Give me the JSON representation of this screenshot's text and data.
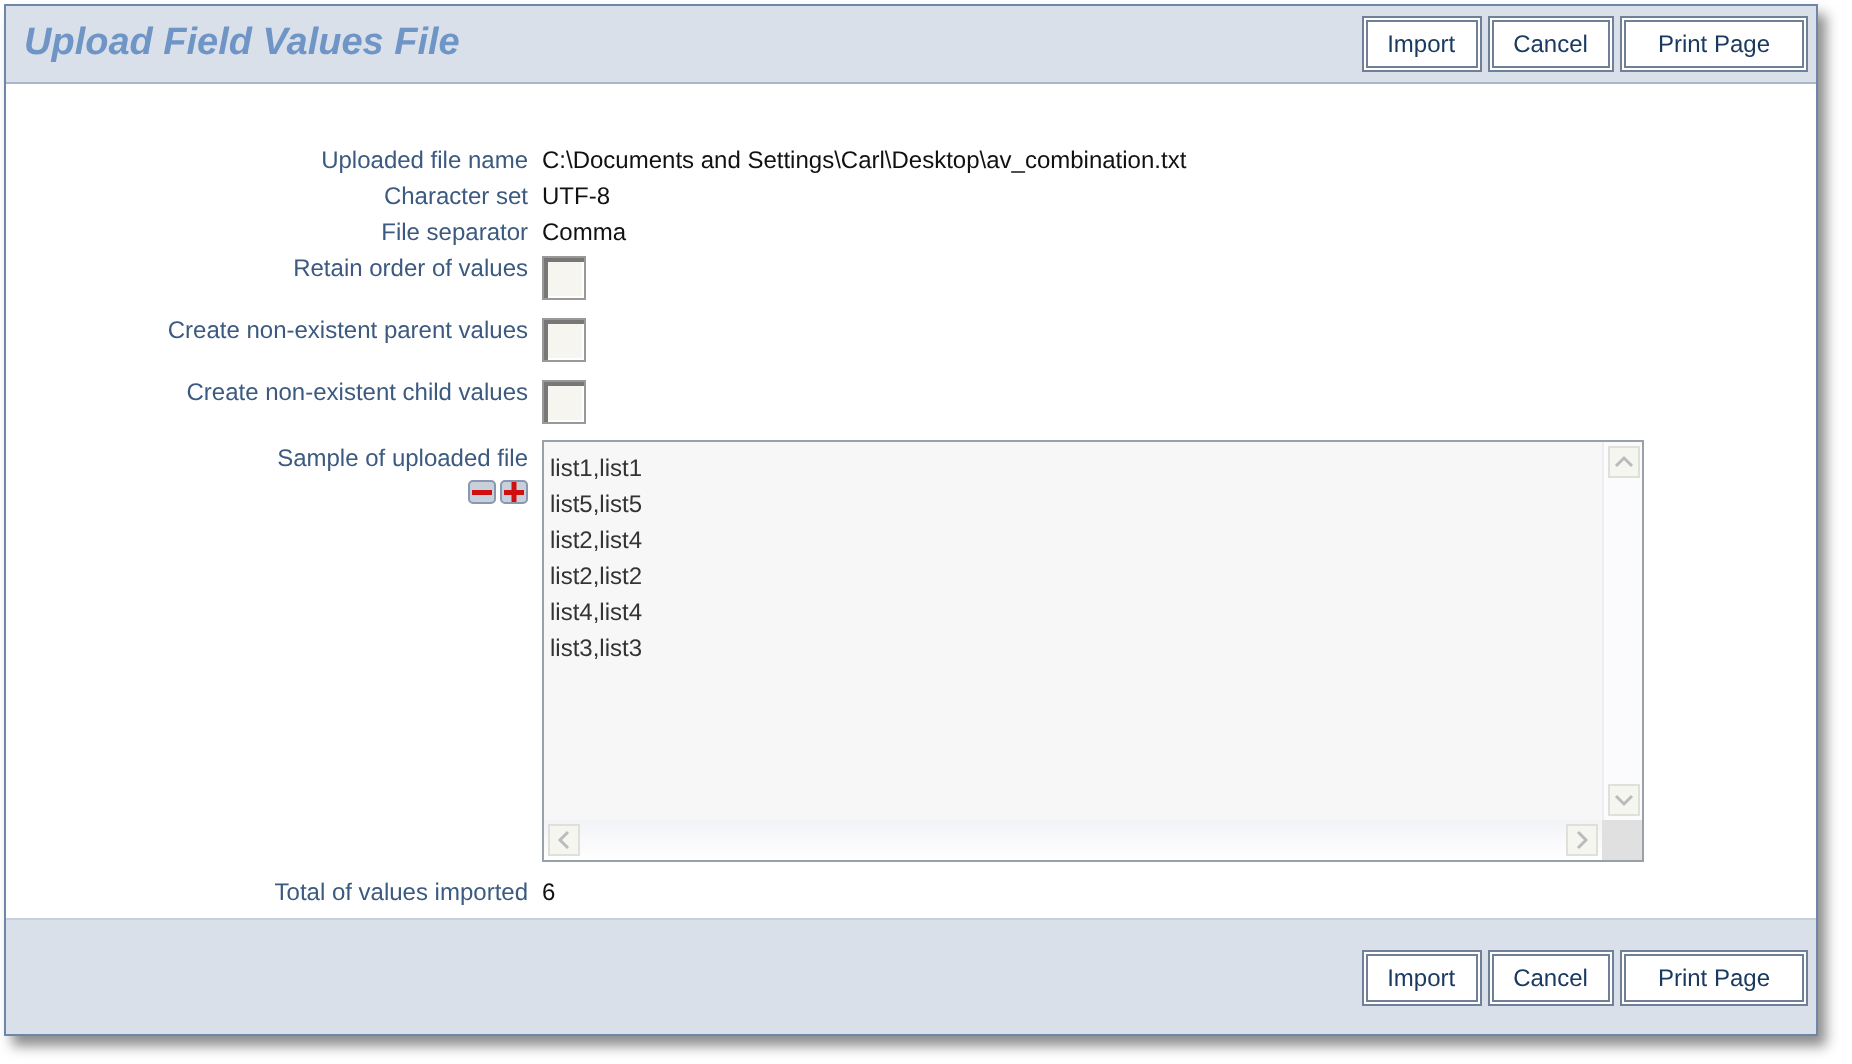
{
  "window": {
    "title": "Upload Field Values File"
  },
  "header_buttons": [
    "Import",
    "Cancel",
    "Print Page"
  ],
  "info": [
    {
      "label": "Uploaded file name",
      "value": "C:\\Documents and Settings\\Carl\\Desktop\\av_combination.txt"
    },
    {
      "label": "Character set",
      "value": "UTF-8"
    },
    {
      "label": "File separator",
      "value": "Comma"
    }
  ],
  "options": [
    {
      "label": "Retain order of values",
      "checked": false
    },
    {
      "label": "Create non-existent parent values",
      "checked": false
    },
    {
      "label": "Create non-existent child values",
      "checked": false
    }
  ],
  "sample": {
    "label": "Sample of uploaded file",
    "lines": [
      "list1,list1",
      "list5,list5",
      "list2,list4",
      "list2,list2",
      "list4,list4",
      "list3,list3"
    ]
  },
  "total": {
    "label": "Total of values imported",
    "value": "6"
  },
  "footer_buttons": [
    "Import",
    "Cancel",
    "Print Page"
  ]
}
